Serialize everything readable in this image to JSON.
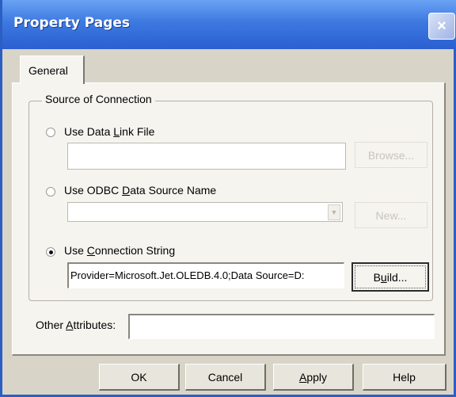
{
  "window": {
    "title": "Property Pages",
    "close_glyph": "×"
  },
  "tabs": [
    {
      "label": "General",
      "selected": true
    }
  ],
  "source_group": {
    "label": "Source of Connection",
    "data_link": {
      "label_pre": "Use Data ",
      "label_u": "L",
      "label_post": "ink File",
      "checked": false,
      "value": "",
      "browse_label": "Browse..."
    },
    "odbc": {
      "label_pre": "Use ODBC ",
      "label_u": "D",
      "label_post": "ata Source Name",
      "checked": false,
      "value": "",
      "new_label": "New..."
    },
    "conn_string": {
      "label_pre": "Use ",
      "label_u": "C",
      "label_post": "onnection String",
      "checked": true,
      "value": "Provider=Microsoft.Jet.OLEDB.4.0;Data Source=D:",
      "build_pre": "B",
      "build_u": "u",
      "build_post": "ild..."
    }
  },
  "other_attributes": {
    "label_pre": "Other ",
    "label_u": "A",
    "label_post": "ttributes:",
    "value": ""
  },
  "footer": {
    "ok_label": "OK",
    "cancel_label": "Cancel",
    "apply_u": "A",
    "apply_post": "pply",
    "help_label": "Help"
  },
  "colors": {
    "titlebar": "#2a5fd0",
    "dialog_bg": "#d9d4c8",
    "panel_bg": "#f5f4ef"
  }
}
